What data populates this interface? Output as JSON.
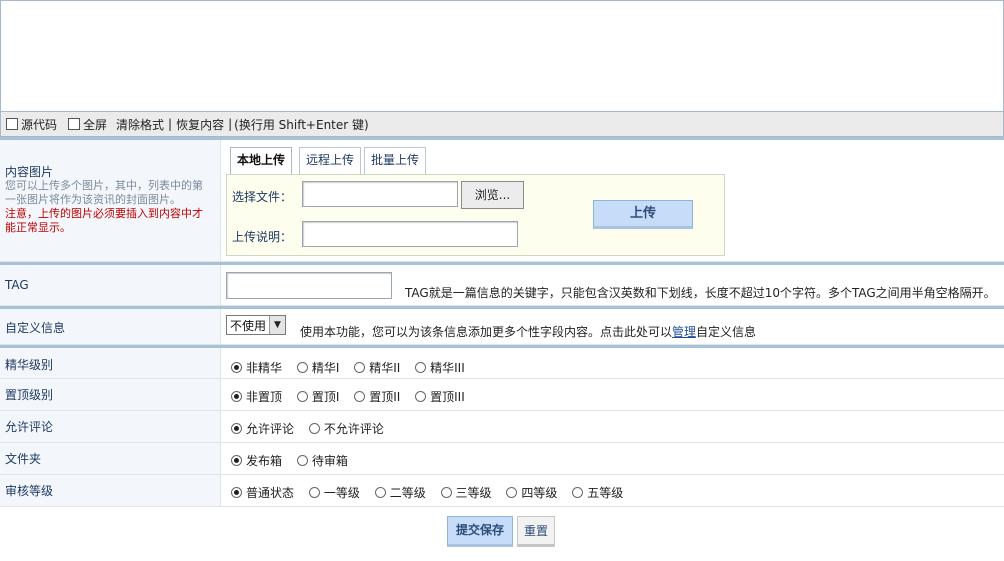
{
  "toolbar": {
    "source_code": "源代码",
    "fullscreen": "全屏",
    "clear_format": "清除格式",
    "sep1": "|",
    "restore": "恢复内容",
    "sep2": "|",
    "newline_hint": "(换行用 Shift+Enter 键)"
  },
  "content_image": {
    "label": "内容图片",
    "desc": "您可以上传多个图片，其中，列表中的第一张图片将作为该资讯的封面图片。",
    "warning": "注意，上传的图片必须要插入到内容中才能正常显示。",
    "tabs": [
      "本地上传",
      "远程上传",
      "批量上传"
    ],
    "choose_file_label": "选择文件：",
    "browse_button": "浏览...",
    "upload_desc_label": "上传说明：",
    "upload_button": "上传"
  },
  "tag": {
    "label": "TAG",
    "hint": "TAG就是一篇信息的关键字，只能包含汉英数和下划线，长度不超过10个字符。多个TAG之间用半角空格隔开。"
  },
  "custom_info": {
    "label": "自定义信息",
    "select_value": "不使用",
    "hint_before": "使用本功能，您可以为该条信息添加更多个性字段内容。点击此处可以",
    "hint_link": "管理",
    "hint_after": "自定义信息"
  },
  "fine_level": {
    "label": "精华级别",
    "options": [
      "非精华",
      "精华I",
      "精华II",
      "精华III"
    ],
    "selected": 0
  },
  "top_level": {
    "label": "置顶级别",
    "options": [
      "非置顶",
      "置顶I",
      "置顶II",
      "置顶III"
    ],
    "selected": 0
  },
  "allow_comment": {
    "label": "允许评论",
    "options": [
      "允许评论",
      "不允许评论"
    ],
    "selected": 0
  },
  "folder": {
    "label": "文件夹",
    "options": [
      "发布箱",
      "待审箱"
    ],
    "selected": 0
  },
  "review_level": {
    "label": "审核等级",
    "options": [
      "普通状态",
      "一等级",
      "二等级",
      "三等级",
      "四等级",
      "五等级"
    ],
    "selected": 0
  },
  "actions": {
    "submit": "提交保存",
    "reset": "重置"
  }
}
